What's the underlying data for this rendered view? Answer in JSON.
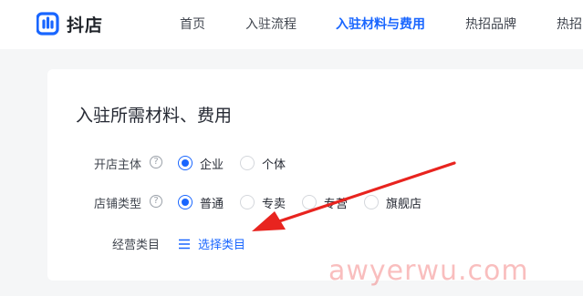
{
  "header": {
    "logo_text": "抖店",
    "nav": [
      {
        "label": "首页",
        "active": false
      },
      {
        "label": "入驻流程",
        "active": false
      },
      {
        "label": "入驻材料与费用",
        "active": true
      },
      {
        "label": "热招品牌",
        "active": false
      },
      {
        "label": "热招",
        "active": false
      }
    ]
  },
  "card": {
    "title": "入驻所需材料、费用",
    "store_subject": {
      "label": "开店主体",
      "help_icon": "?",
      "options": [
        {
          "label": "企业",
          "checked": true
        },
        {
          "label": "个体",
          "checked": false
        }
      ]
    },
    "store_type": {
      "label": "店铺类型",
      "help_icon": "?",
      "options": [
        {
          "label": "普通",
          "checked": true
        },
        {
          "label": "专卖",
          "checked": false
        },
        {
          "label": "专营",
          "checked": false
        },
        {
          "label": "旗舰店",
          "checked": false
        }
      ]
    },
    "category": {
      "label": "经营类目",
      "link_label": "选择类目"
    }
  },
  "watermark": "awyerwu.com",
  "colors": {
    "accent": "#1966ff",
    "arrow": "#e8241f",
    "watermark": "#ee4646"
  }
}
